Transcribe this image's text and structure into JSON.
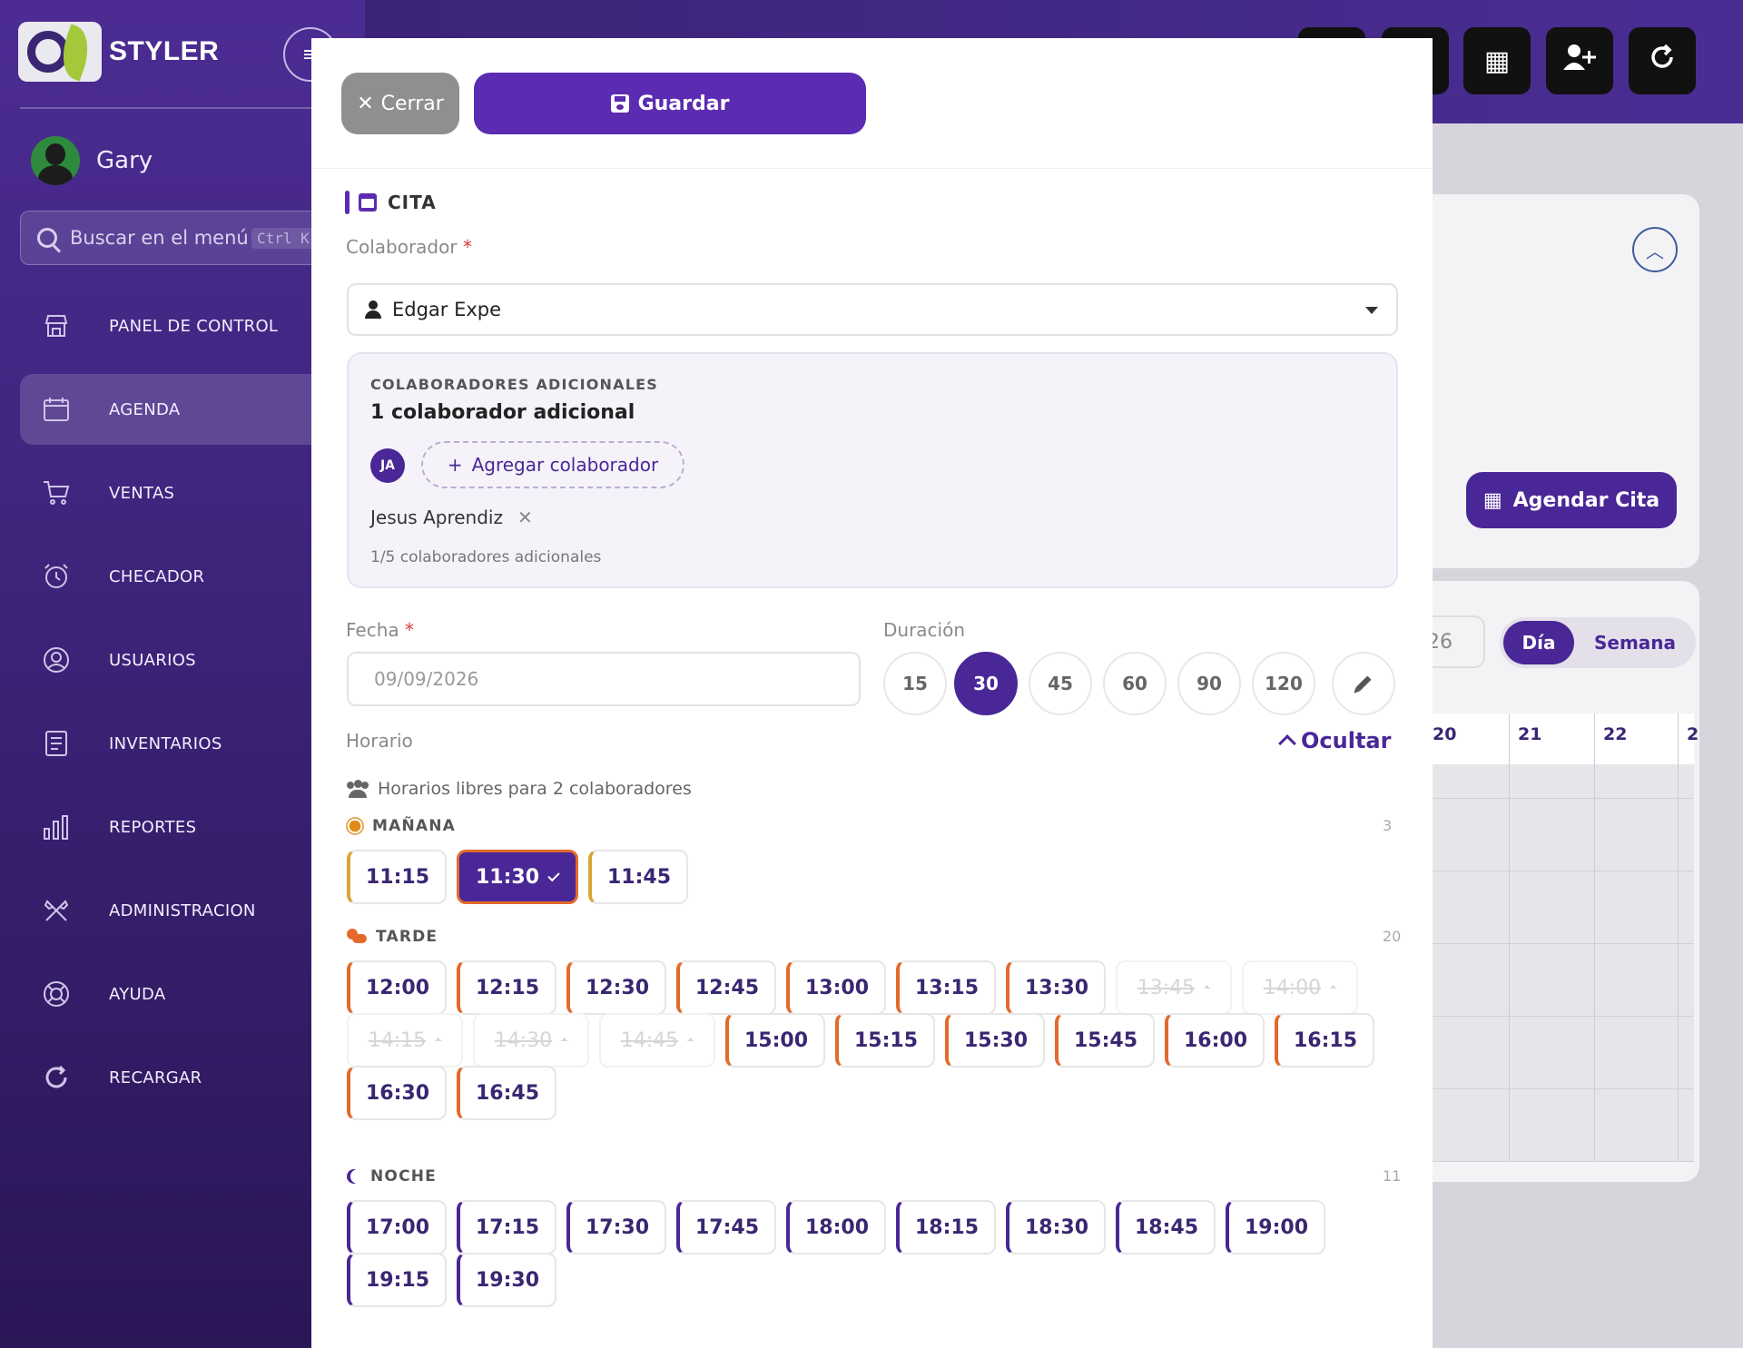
{
  "sidebar": {
    "logo_text": "STYLER",
    "user_name": "Gary",
    "search_placeholder": "Buscar en el menú",
    "search_shortcut": "Ctrl K",
    "items": [
      {
        "label": "PANEL DE CONTROL",
        "icon": "store-icon"
      },
      {
        "label": "AGENDA",
        "icon": "calendar-icon",
        "active": true
      },
      {
        "label": "VENTAS",
        "icon": "cart-icon"
      },
      {
        "label": "CHECADOR",
        "icon": "alarm-clock-icon"
      },
      {
        "label": "USUARIOS",
        "icon": "user-circle-icon"
      },
      {
        "label": "INVENTARIOS",
        "icon": "list-icon"
      },
      {
        "label": "REPORTES",
        "icon": "bar-chart-icon"
      },
      {
        "label": "ADMINISTRACION",
        "icon": "tools-icon"
      },
      {
        "label": "AYUDA",
        "icon": "lifebuoy-icon"
      },
      {
        "label": "RECARGAR",
        "icon": "refresh-icon"
      }
    ]
  },
  "background": {
    "agendar_label": "Agendar Cita",
    "date_fragment": "26",
    "view_dia": "Día",
    "view_semana": "Semana",
    "days": [
      "20",
      "21",
      "22",
      "2"
    ]
  },
  "modal": {
    "cerrar_label": "Cerrar",
    "guardar_label": "Guardar",
    "section_title": "CITA",
    "colaborador_label": "Colaborador",
    "required_mark": "*",
    "colaborador_value": "Edgar Expe",
    "adicionales": {
      "heading": "COLABORADORES ADICIONALES",
      "title": "1 colaborador adicional",
      "badge": "JA",
      "add_label": "Agregar colaborador",
      "collaborator_name": "Jesus Aprendiz",
      "count_text": "1/5 colaboradores adicionales"
    },
    "fecha_label": "Fecha",
    "fecha_value": "09/09/2026",
    "duracion_label": "Duración",
    "durations": [
      "15",
      "30",
      "45",
      "60",
      "90",
      "120"
    ],
    "duration_selected": "30",
    "horario_label": "Horario",
    "ocultar_label": "Ocultar",
    "libres_text": "Horarios libres para 2 colaboradores",
    "manana": {
      "label": "MAÑANA",
      "count": "3",
      "slots": [
        "11:15",
        "11:30",
        "11:45"
      ],
      "selected": "11:30"
    },
    "tarde": {
      "label": "TARDE",
      "count": "20",
      "slots": [
        "12:00",
        "12:15",
        "12:30",
        "12:45",
        "13:00",
        "13:15",
        "13:30",
        "13:45",
        "14:00",
        "14:15",
        "14:30",
        "14:45",
        "15:00",
        "15:15",
        "15:30",
        "15:45",
        "16:00",
        "16:15",
        "16:30",
        "16:45"
      ],
      "disabled": [
        "13:45",
        "14:00",
        "14:15",
        "14:30",
        "14:45"
      ]
    },
    "noche": {
      "label": "NOCHE",
      "count": "11",
      "slots": [
        "17:00",
        "17:15",
        "17:30",
        "17:45",
        "18:00",
        "18:15",
        "18:30",
        "18:45",
        "19:00",
        "19:15",
        "19:30"
      ]
    }
  }
}
